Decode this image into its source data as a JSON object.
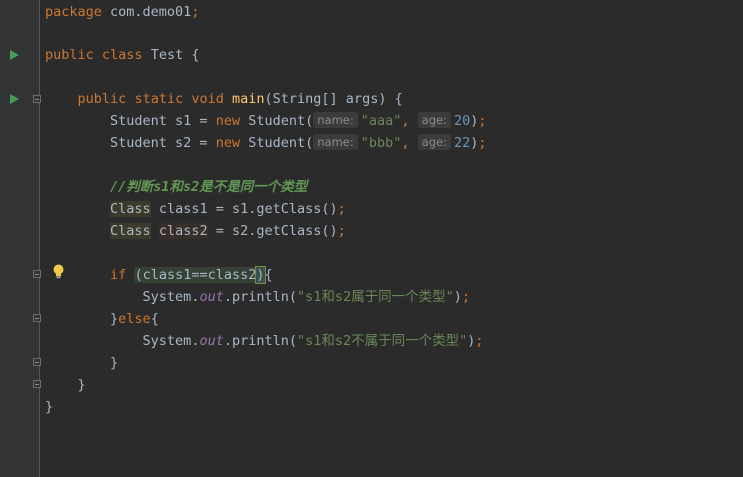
{
  "editor": {
    "lines": {
      "l1": {
        "kw": "package",
        "text": " com.demo01",
        "semi": ";"
      },
      "l3": {
        "kw1": "public",
        "kw2": "class",
        "text": " Test {"
      },
      "l5": {
        "kw1": "public",
        "kw2": "static",
        "kw3": "void",
        "method": "main",
        "rest": "(String[] args) {"
      },
      "l6": {
        "pre": "Student s1 = ",
        "kw": "new",
        "call": " Student(",
        "hint1": "name:",
        "str": "\"aaa\"",
        "comma": ", ",
        "hint2": "age:",
        "num": "20",
        "close": ")",
        "semi": ";"
      },
      "l7": {
        "pre": "Student s2 = ",
        "kw": "new",
        "call": " Student(",
        "hint1": "name:",
        "str": "\"bbb\"",
        "comma": ", ",
        "hint2": "age:",
        "num": "22",
        "close": ")",
        "semi": ";"
      },
      "l9": {
        "comment": "//判断s1和s2是不是同一个类型"
      },
      "l10": {
        "type": "Class",
        "sp": " ",
        "var": "class1",
        "rest": " = s1.getClass()",
        "semi": ";"
      },
      "l11": {
        "type": "Class",
        "sp": " ",
        "var": "class2",
        "rest": " = s2.getClass()",
        "semi": ";"
      },
      "l13": {
        "kw": "if",
        "sp": " ",
        "open": "(",
        "cond1": "class1==class",
        "cond2": "2",
        "close": ")",
        "brace": "{"
      },
      "l14": {
        "pre": "System.",
        "field": "out",
        "call": ".println(",
        "str": "\"s1和s2属于同一个类型\"",
        "close": ")",
        "semi": ";"
      },
      "l15": {
        "pre": "}",
        "kw": "else",
        "brace": "{"
      },
      "l16": {
        "pre": "System.",
        "field": "out",
        "call": ".println(",
        "str": "\"s1和s2不属于同一个类型\"",
        "close": ")",
        "semi": ";"
      },
      "l17": {
        "text": "}"
      },
      "l18": {
        "text": "}"
      },
      "l19": {
        "text": "}"
      }
    },
    "icons": {
      "run": "run-gutter-icon",
      "fold": "fold-marker-icon",
      "bulb": "intention-bulb-icon"
    },
    "colors": {
      "background": "#2b2b2b",
      "gutter": "#313335",
      "keyword": "#cc7832",
      "string": "#6a8759",
      "number": "#6897bb",
      "method": "#ffc66d",
      "default_text": "#a9b7c6",
      "static_field": "#9876aa",
      "run_icon": "#499c54",
      "bulb": "#f0c94d"
    }
  }
}
